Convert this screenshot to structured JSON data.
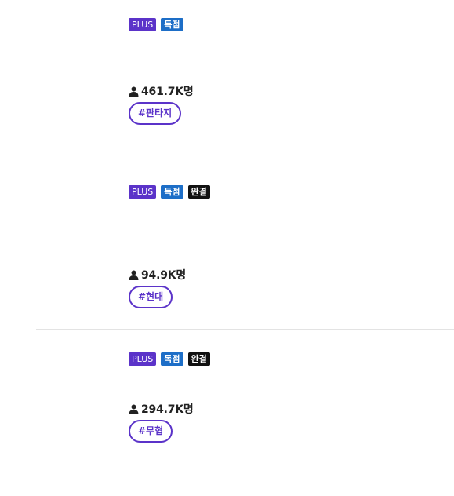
{
  "items": [
    {
      "badges": [
        "PLUS",
        "독점"
      ],
      "readers": "461.7K명",
      "tag": "#판타지"
    },
    {
      "badges": [
        "PLUS",
        "독점",
        "완결"
      ],
      "readers": "94.9K명",
      "tag": "#현대"
    },
    {
      "badges": [
        "PLUS",
        "독점",
        "완결"
      ],
      "readers": "294.7K명",
      "tag": "#무협"
    }
  ],
  "icons": {
    "readers": "person-icon"
  },
  "colors": {
    "plus": "#5b33c9",
    "exclusive": "#1d6ec7",
    "completed": "#111111",
    "tag_border": "#5b33c9"
  }
}
